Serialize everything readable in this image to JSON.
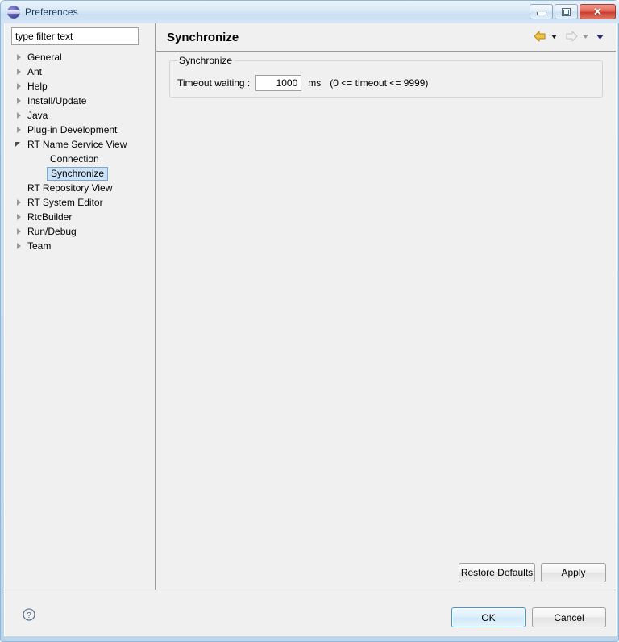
{
  "window": {
    "title": "Preferences",
    "icon": "eclipse-sphere-icon",
    "controls": {
      "minimize_label": "—",
      "restore_label": "❐",
      "close_label": "✕"
    }
  },
  "colors": {
    "frame": "#bdd6ec",
    "client_bg": "#f0f0f0",
    "selection_bg": "#cde3f7",
    "selection_border": "#7aa5cd",
    "close_button": "#c73c2c",
    "default_button_border": "#3c9ad4",
    "back_arrow": "#e8ab29",
    "forward_arrow": "#d8d8d8",
    "menu_chevron": "#2d2d6e",
    "divider": "#9a9a9a"
  },
  "filter": {
    "placeholder": "type filter text",
    "value": ""
  },
  "tree": {
    "items": [
      {
        "label": "General",
        "indent": 0,
        "twisty": "collapsed",
        "selected": false
      },
      {
        "label": "Ant",
        "indent": 0,
        "twisty": "collapsed",
        "selected": false
      },
      {
        "label": "Help",
        "indent": 0,
        "twisty": "collapsed",
        "selected": false
      },
      {
        "label": "Install/Update",
        "indent": 0,
        "twisty": "collapsed",
        "selected": false
      },
      {
        "label": "Java",
        "indent": 0,
        "twisty": "collapsed",
        "selected": false
      },
      {
        "label": "Plug-in Development",
        "indent": 0,
        "twisty": "collapsed",
        "selected": false
      },
      {
        "label": "RT Name Service View",
        "indent": 0,
        "twisty": "expanded",
        "selected": false
      },
      {
        "label": "Connection",
        "indent": 1,
        "twisty": "none",
        "selected": false
      },
      {
        "label": "Synchronize",
        "indent": 1,
        "twisty": "none",
        "selected": true
      },
      {
        "label": "RT Repository View",
        "indent": 0,
        "twisty": "none",
        "selected": false
      },
      {
        "label": "RT System Editor",
        "indent": 0,
        "twisty": "collapsed",
        "selected": false
      },
      {
        "label": "RtcBuilder",
        "indent": 0,
        "twisty": "collapsed",
        "selected": false
      },
      {
        "label": "Run/Debug",
        "indent": 0,
        "twisty": "collapsed",
        "selected": false
      },
      {
        "label": "Team",
        "indent": 0,
        "twisty": "collapsed",
        "selected": false
      }
    ]
  },
  "page": {
    "title": "Synchronize",
    "toolbar": {
      "back_icon": "back-arrow-icon",
      "back_menu_icon": "chevron-down-icon",
      "forward_icon": "forward-arrow-icon",
      "forward_menu_icon": "chevron-down-icon",
      "view_menu_icon": "chevron-down-icon"
    },
    "group": {
      "label": "Synchronize",
      "timeout_label": "Timeout waiting :",
      "timeout_value": "1000",
      "timeout_placeholder": "",
      "timeout_unit": "ms",
      "timeout_hint": "(0 <= timeout <= 9999)"
    },
    "restore_defaults_label": "Restore Defaults",
    "apply_label": "Apply"
  },
  "footer": {
    "help_icon": "help-question-icon",
    "ok_label": "OK",
    "cancel_label": "Cancel"
  }
}
